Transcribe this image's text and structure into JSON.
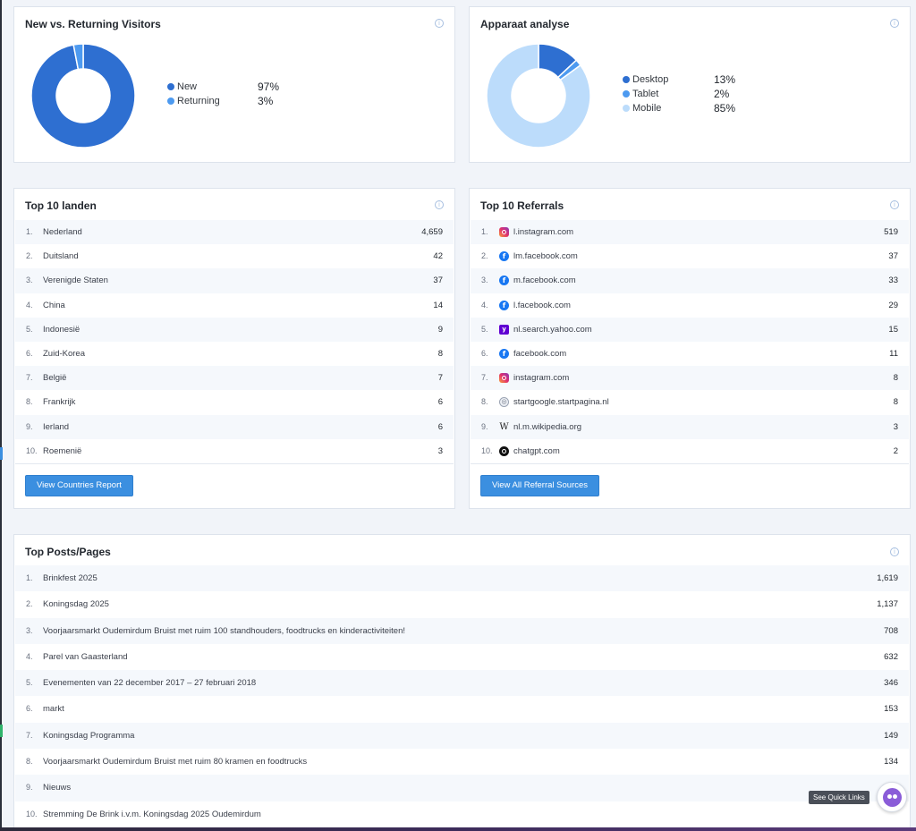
{
  "visitors": {
    "title": "New vs. Returning Visitors",
    "legend": [
      {
        "label": "New",
        "pct": "97%",
        "value": 97,
        "color": "#2e6fd1"
      },
      {
        "label": "Returning",
        "pct": "3%",
        "value": 3,
        "color": "#4d9af0"
      }
    ]
  },
  "devices": {
    "title": "Apparaat analyse",
    "legend": [
      {
        "label": "Desktop",
        "pct": "13%",
        "value": 13,
        "color": "#2e6fd1"
      },
      {
        "label": "Tablet",
        "pct": "2%",
        "value": 2,
        "color": "#4d9af0"
      },
      {
        "label": "Mobile",
        "pct": "85%",
        "value": 85,
        "color": "#bcdcfb"
      }
    ]
  },
  "countries": {
    "title": "Top 10 landen",
    "rows": [
      {
        "num": "1.",
        "label": "Nederland",
        "value": "4,659"
      },
      {
        "num": "2.",
        "label": "Duitsland",
        "value": "42"
      },
      {
        "num": "3.",
        "label": "Verenigde Staten",
        "value": "37"
      },
      {
        "num": "4.",
        "label": "China",
        "value": "14"
      },
      {
        "num": "5.",
        "label": "Indonesië",
        "value": "9"
      },
      {
        "num": "6.",
        "label": "Zuid-Korea",
        "value": "8"
      },
      {
        "num": "7.",
        "label": "België",
        "value": "7"
      },
      {
        "num": "8.",
        "label": "Frankrijk",
        "value": "6"
      },
      {
        "num": "9.",
        "label": "Ierland",
        "value": "6"
      },
      {
        "num": "10.",
        "label": "Roemenië",
        "value": "3"
      }
    ],
    "button": "View Countries Report"
  },
  "referrals": {
    "title": "Top 10 Referrals",
    "rows": [
      {
        "num": "1.",
        "label": "l.instagram.com",
        "value": "519",
        "icon": "instagram-icon"
      },
      {
        "num": "2.",
        "label": "lm.facebook.com",
        "value": "37",
        "icon": "facebook-icon"
      },
      {
        "num": "3.",
        "label": "m.facebook.com",
        "value": "33",
        "icon": "facebook-icon"
      },
      {
        "num": "4.",
        "label": "l.facebook.com",
        "value": "29",
        "icon": "facebook-icon"
      },
      {
        "num": "5.",
        "label": "nl.search.yahoo.com",
        "value": "15",
        "icon": "yahoo-icon"
      },
      {
        "num": "6.",
        "label": "facebook.com",
        "value": "11",
        "icon": "facebook-icon"
      },
      {
        "num": "7.",
        "label": "instagram.com",
        "value": "8",
        "icon": "instagram-icon"
      },
      {
        "num": "8.",
        "label": "startgoogle.startpagina.nl",
        "value": "8",
        "icon": "globe-icon"
      },
      {
        "num": "9.",
        "label": "nl.m.wikipedia.org",
        "value": "3",
        "icon": "wikipedia-icon"
      },
      {
        "num": "10.",
        "label": "chatgpt.com",
        "value": "2",
        "icon": "chatgpt-icon"
      }
    ],
    "button": "View All Referral Sources"
  },
  "posts": {
    "title": "Top Posts/Pages",
    "rows": [
      {
        "num": "1.",
        "label": "Brinkfest 2025",
        "value": "1,619"
      },
      {
        "num": "2.",
        "label": "Koningsdag 2025",
        "value": "1,137"
      },
      {
        "num": "3.",
        "label": "Voorjaarsmarkt Oudemirdum Bruist met ruim 100 standhouders, foodtrucks en kinderactiviteiten!",
        "value": "708"
      },
      {
        "num": "4.",
        "label": "Parel van Gaasterland",
        "value": "632"
      },
      {
        "num": "5.",
        "label": "Evenementen van 22 december 2017 – 27 februari 2018",
        "value": "346"
      },
      {
        "num": "6.",
        "label": "markt",
        "value": "153"
      },
      {
        "num": "7.",
        "label": "Koningsdag Programma",
        "value": "149"
      },
      {
        "num": "8.",
        "label": "Voorjaarsmarkt Oudemirdum Bruist met ruim 80 kramen en foodtrucks",
        "value": "134"
      },
      {
        "num": "9.",
        "label": "Nieuws",
        "value": ""
      },
      {
        "num": "10.",
        "label": "Stremming De Brink i.v.m. Koningsdag 2025 Oudemirdum",
        "value": ""
      }
    ]
  },
  "quick_links": {
    "label": "See Quick Links"
  }
}
